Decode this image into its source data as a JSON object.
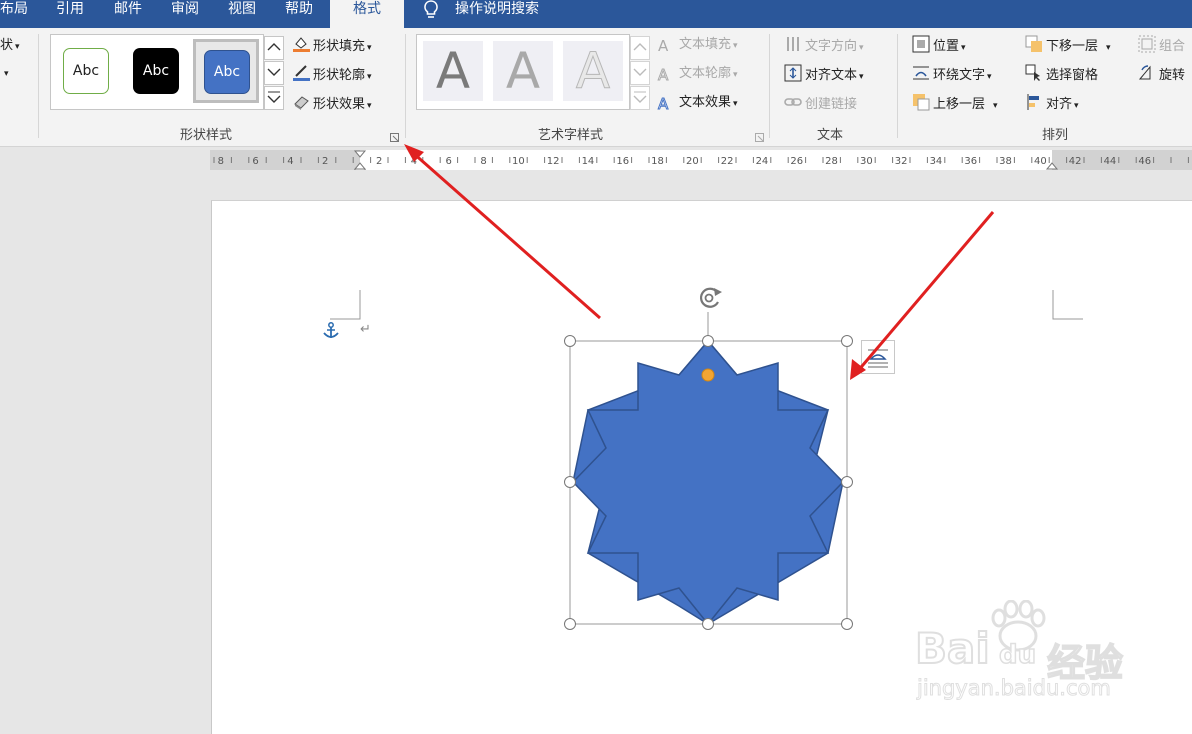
{
  "tabs": [
    "布局",
    "引用",
    "邮件",
    "审阅",
    "视图",
    "帮助"
  ],
  "active_tab": "格式",
  "tell_me": "操作说明搜索",
  "left_cut": {
    "item1": "状",
    "item2": "▾"
  },
  "shape_styles": {
    "label": "形状样式",
    "swatch_text": "Abc",
    "fill": "形状填充",
    "outline": "形状轮廓",
    "effect": "形状效果"
  },
  "wordart": {
    "label": "艺术字样式",
    "letter": "A",
    "text_fill": "文本填充",
    "text_outline": "文本轮廓",
    "text_effect": "文本效果"
  },
  "text_group": {
    "label": "文本",
    "direction": "文字方向",
    "align_text": "对齐文本",
    "link": "创建链接"
  },
  "arrange": {
    "label": "排列",
    "position": "位置",
    "wrap": "环绕文字",
    "bring_forward": "上移一层",
    "send_backward": "下移一层",
    "selection_pane": "选择窗格",
    "align": "对齐",
    "group": "组合",
    "rotate": "旋转"
  },
  "ruler_left": [
    "8",
    "6",
    "4",
    "2"
  ],
  "ruler_right": [
    "2",
    "4",
    "6",
    "8",
    "10",
    "12",
    "14",
    "16",
    "18",
    "20",
    "22",
    "24",
    "26",
    "28",
    "30",
    "32",
    "34",
    "36",
    "38",
    "40",
    "42",
    "44",
    "46"
  ],
  "watermark": {
    "brand": "Bai",
    "du": "du",
    "jy": "经验",
    "url": "jingyan.baidu.com"
  },
  "colors": {
    "accent": "#2b579a",
    "shape_fill": "#4472c4",
    "shape_stroke": "#2f528f",
    "arrow": "#e02020"
  }
}
